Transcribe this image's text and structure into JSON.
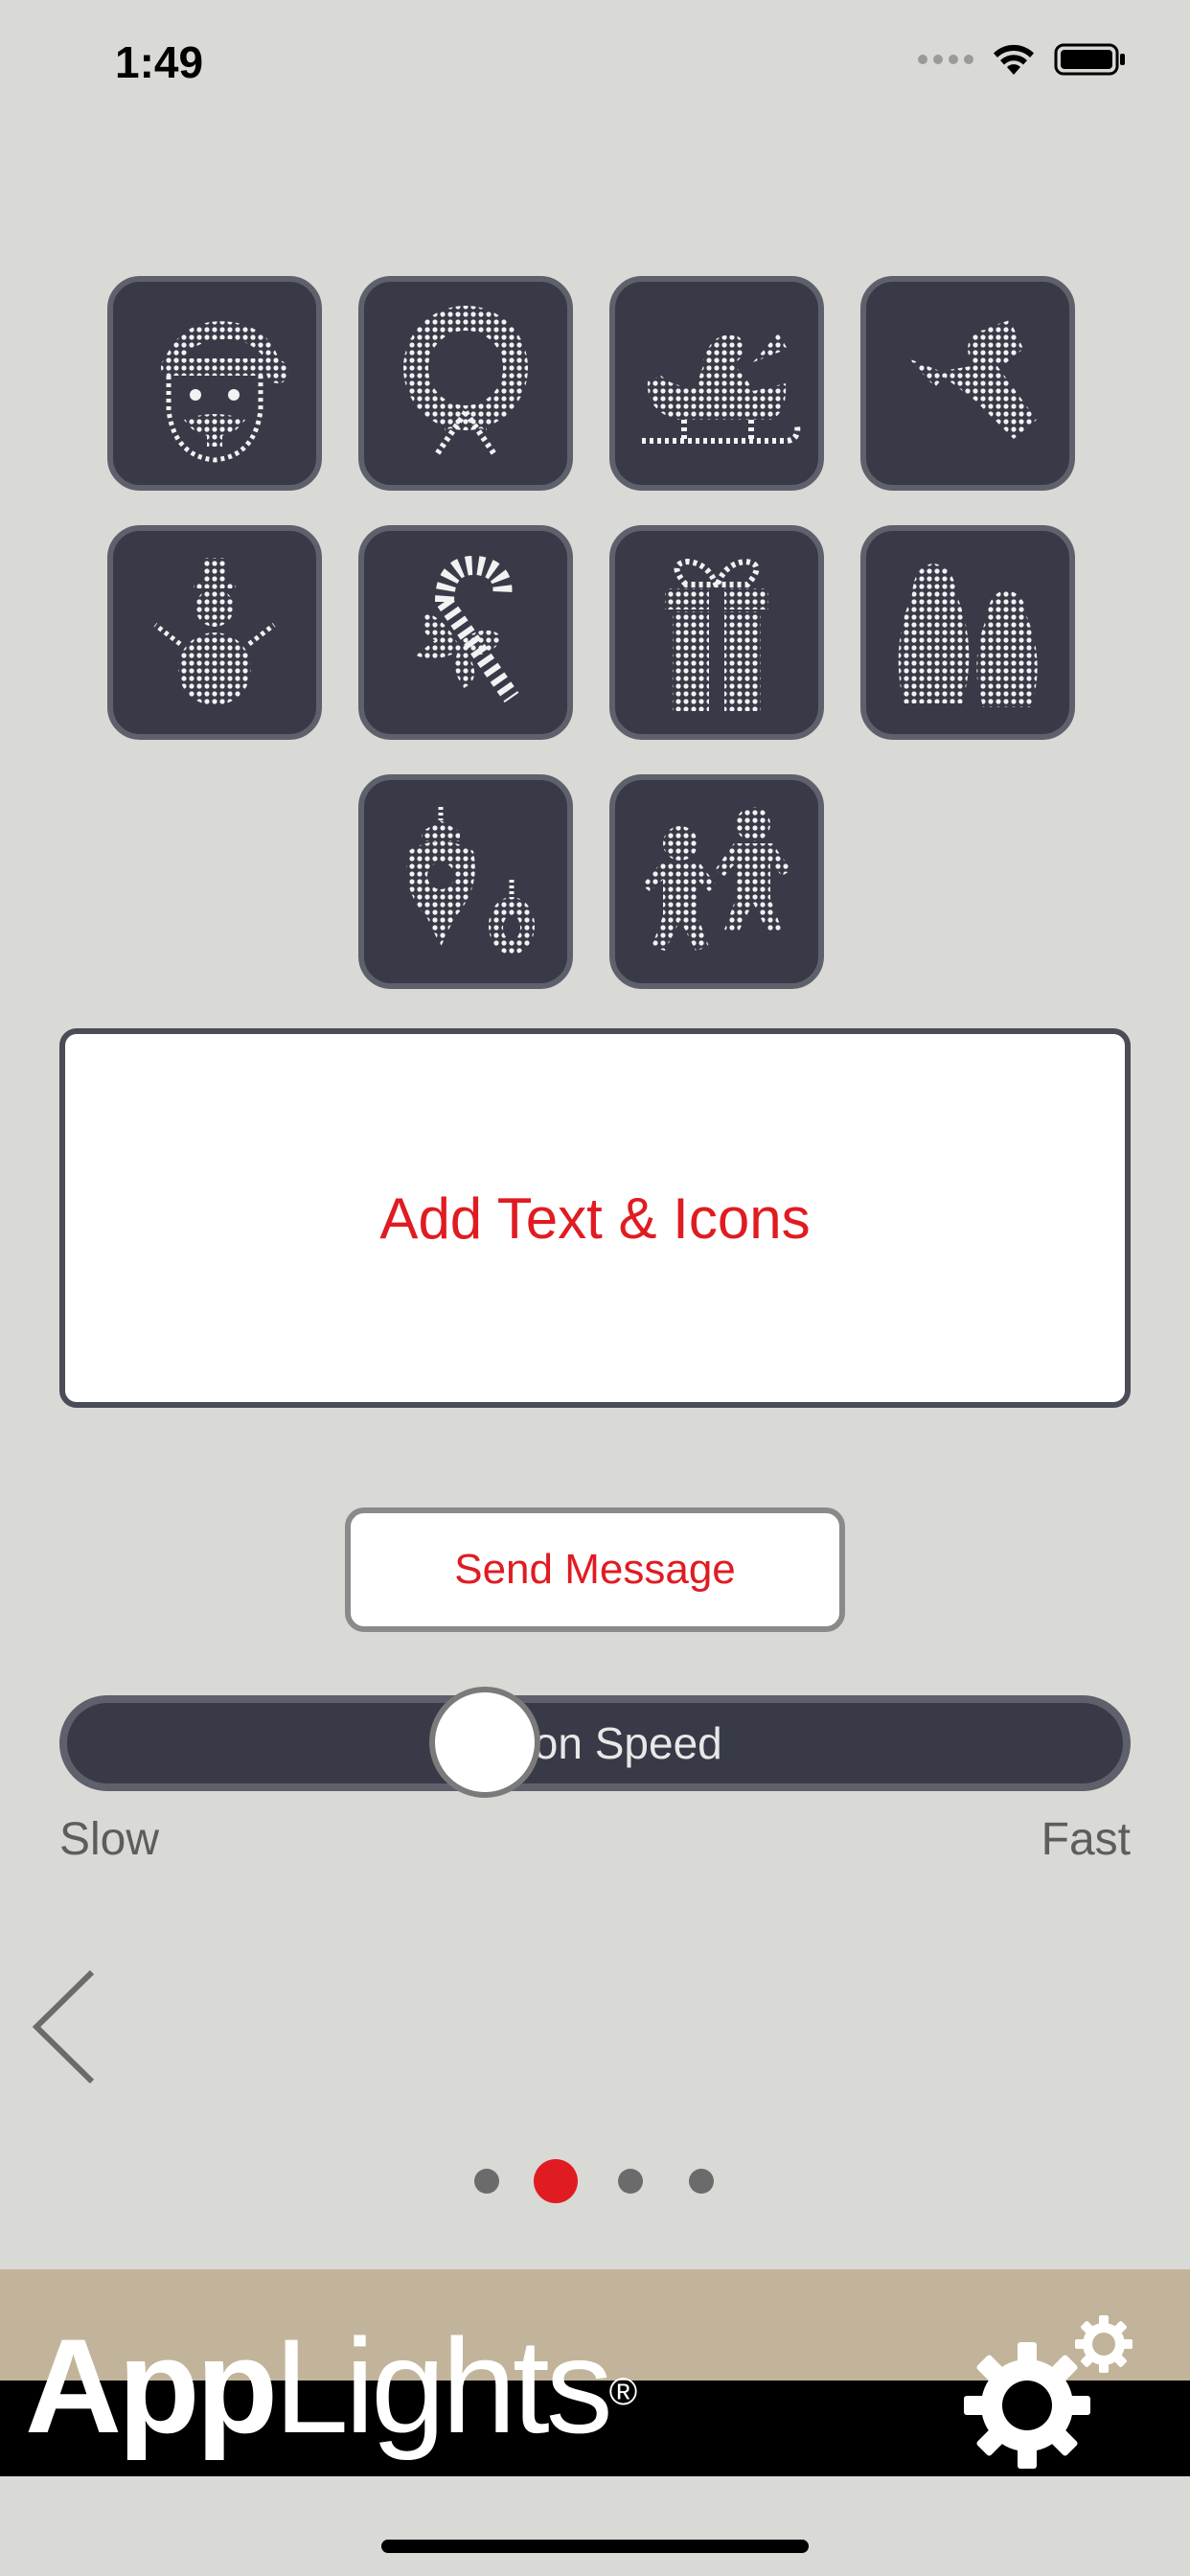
{
  "status_bar": {
    "time": "1:49"
  },
  "icons": [
    {
      "name": "santa-icon"
    },
    {
      "name": "wreath-icon"
    },
    {
      "name": "sleigh-icon"
    },
    {
      "name": "angel-icon"
    },
    {
      "name": "snowman-icon"
    },
    {
      "name": "candy-cane-icon"
    },
    {
      "name": "gift-icon"
    },
    {
      "name": "penguins-icon"
    },
    {
      "name": "ornaments-icon"
    },
    {
      "name": "gingerbread-icon"
    }
  ],
  "text_box": {
    "label": "Add Text & Icons"
  },
  "send_button": {
    "label": "Send Message"
  },
  "slider": {
    "label": "Animation Speed",
    "visible_label": "ation Speed",
    "min_label": "Slow",
    "max_label": "Fast",
    "value": 0.32
  },
  "pager": {
    "count": 4,
    "active_index": 1
  },
  "brand": {
    "logo_bold": "App",
    "logo_light": "Lights",
    "logo_mark": "®"
  },
  "colors": {
    "accent": "#e01b22",
    "tile": "#383a47",
    "background": "#d9d9d6",
    "brand_bar": "#c2b49a"
  }
}
